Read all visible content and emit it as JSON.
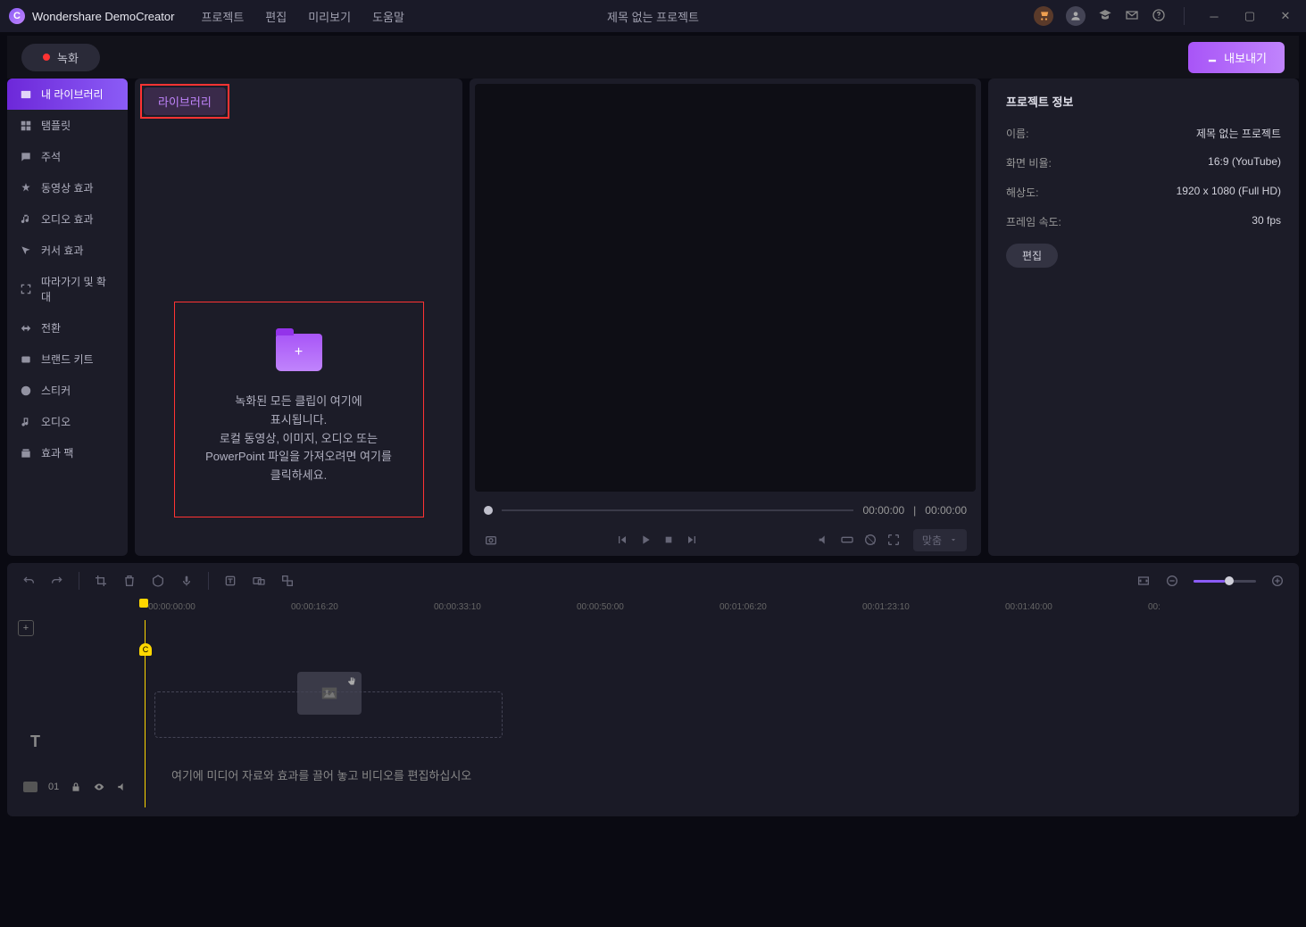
{
  "app_name": "Wondershare DemoCreator",
  "menus": {
    "project": "프로젝트",
    "edit": "편집",
    "preview": "미리보기",
    "help": "도움말"
  },
  "doc_title": "제목 없는 프로젝트",
  "record_label": "녹화",
  "export_label": "내보내기",
  "sidebar": {
    "items": [
      {
        "label": "내 라이브러리",
        "icon": "film"
      },
      {
        "label": "탬플릿",
        "icon": "grid"
      },
      {
        "label": "주석",
        "icon": "chat"
      },
      {
        "label": "동영상 효과",
        "icon": "magic"
      },
      {
        "label": "오디오 효과",
        "icon": "music"
      },
      {
        "label": "커서 효과",
        "icon": "cursor"
      },
      {
        "label": "따라가기 및 확대",
        "icon": "zoom"
      },
      {
        "label": "전환",
        "icon": "transition"
      },
      {
        "label": "브랜드 키트",
        "icon": "box"
      },
      {
        "label": "스티커",
        "icon": "smile"
      },
      {
        "label": "오디오",
        "icon": "note"
      },
      {
        "label": "효과 팩",
        "icon": "pack"
      }
    ]
  },
  "library_tab": "라이브러리",
  "dropzone": {
    "line1": "녹화된 모든 클립이 여기에",
    "line2": "표시됩니다.",
    "line3": "로컬 동영상, 이미지, 오디오 또는",
    "line4": "PowerPoint 파일을 가져오려면 여기를",
    "line5": "클릭하세요."
  },
  "preview": {
    "current": "00:00:00",
    "total": "00:00:00",
    "fit_label": "맞춤"
  },
  "info": {
    "title": "프로젝트 정보",
    "name_label": "이름:",
    "name_value": "제목 없는 프로젝트",
    "aspect_label": "화면 비율:",
    "aspect_value": "16:9 (YouTube)",
    "res_label": "해상도:",
    "res_value": "1920 x 1080 (Full HD)",
    "fps_label": "프레임 속도:",
    "fps_value": "30 fps",
    "edit_label": "편집"
  },
  "ruler": [
    "00:00:00:00",
    "00:00:16:20",
    "00:00:33:10",
    "00:00:50:00",
    "00:01:06:20",
    "00:01:23:10",
    "00:01:40:00",
    "00:"
  ],
  "timeline_hint": "여기에 미디어 자료와 효과를 끌어 놓고 비디오를 편집하십시오",
  "track_number": "01",
  "marker_label": "C"
}
